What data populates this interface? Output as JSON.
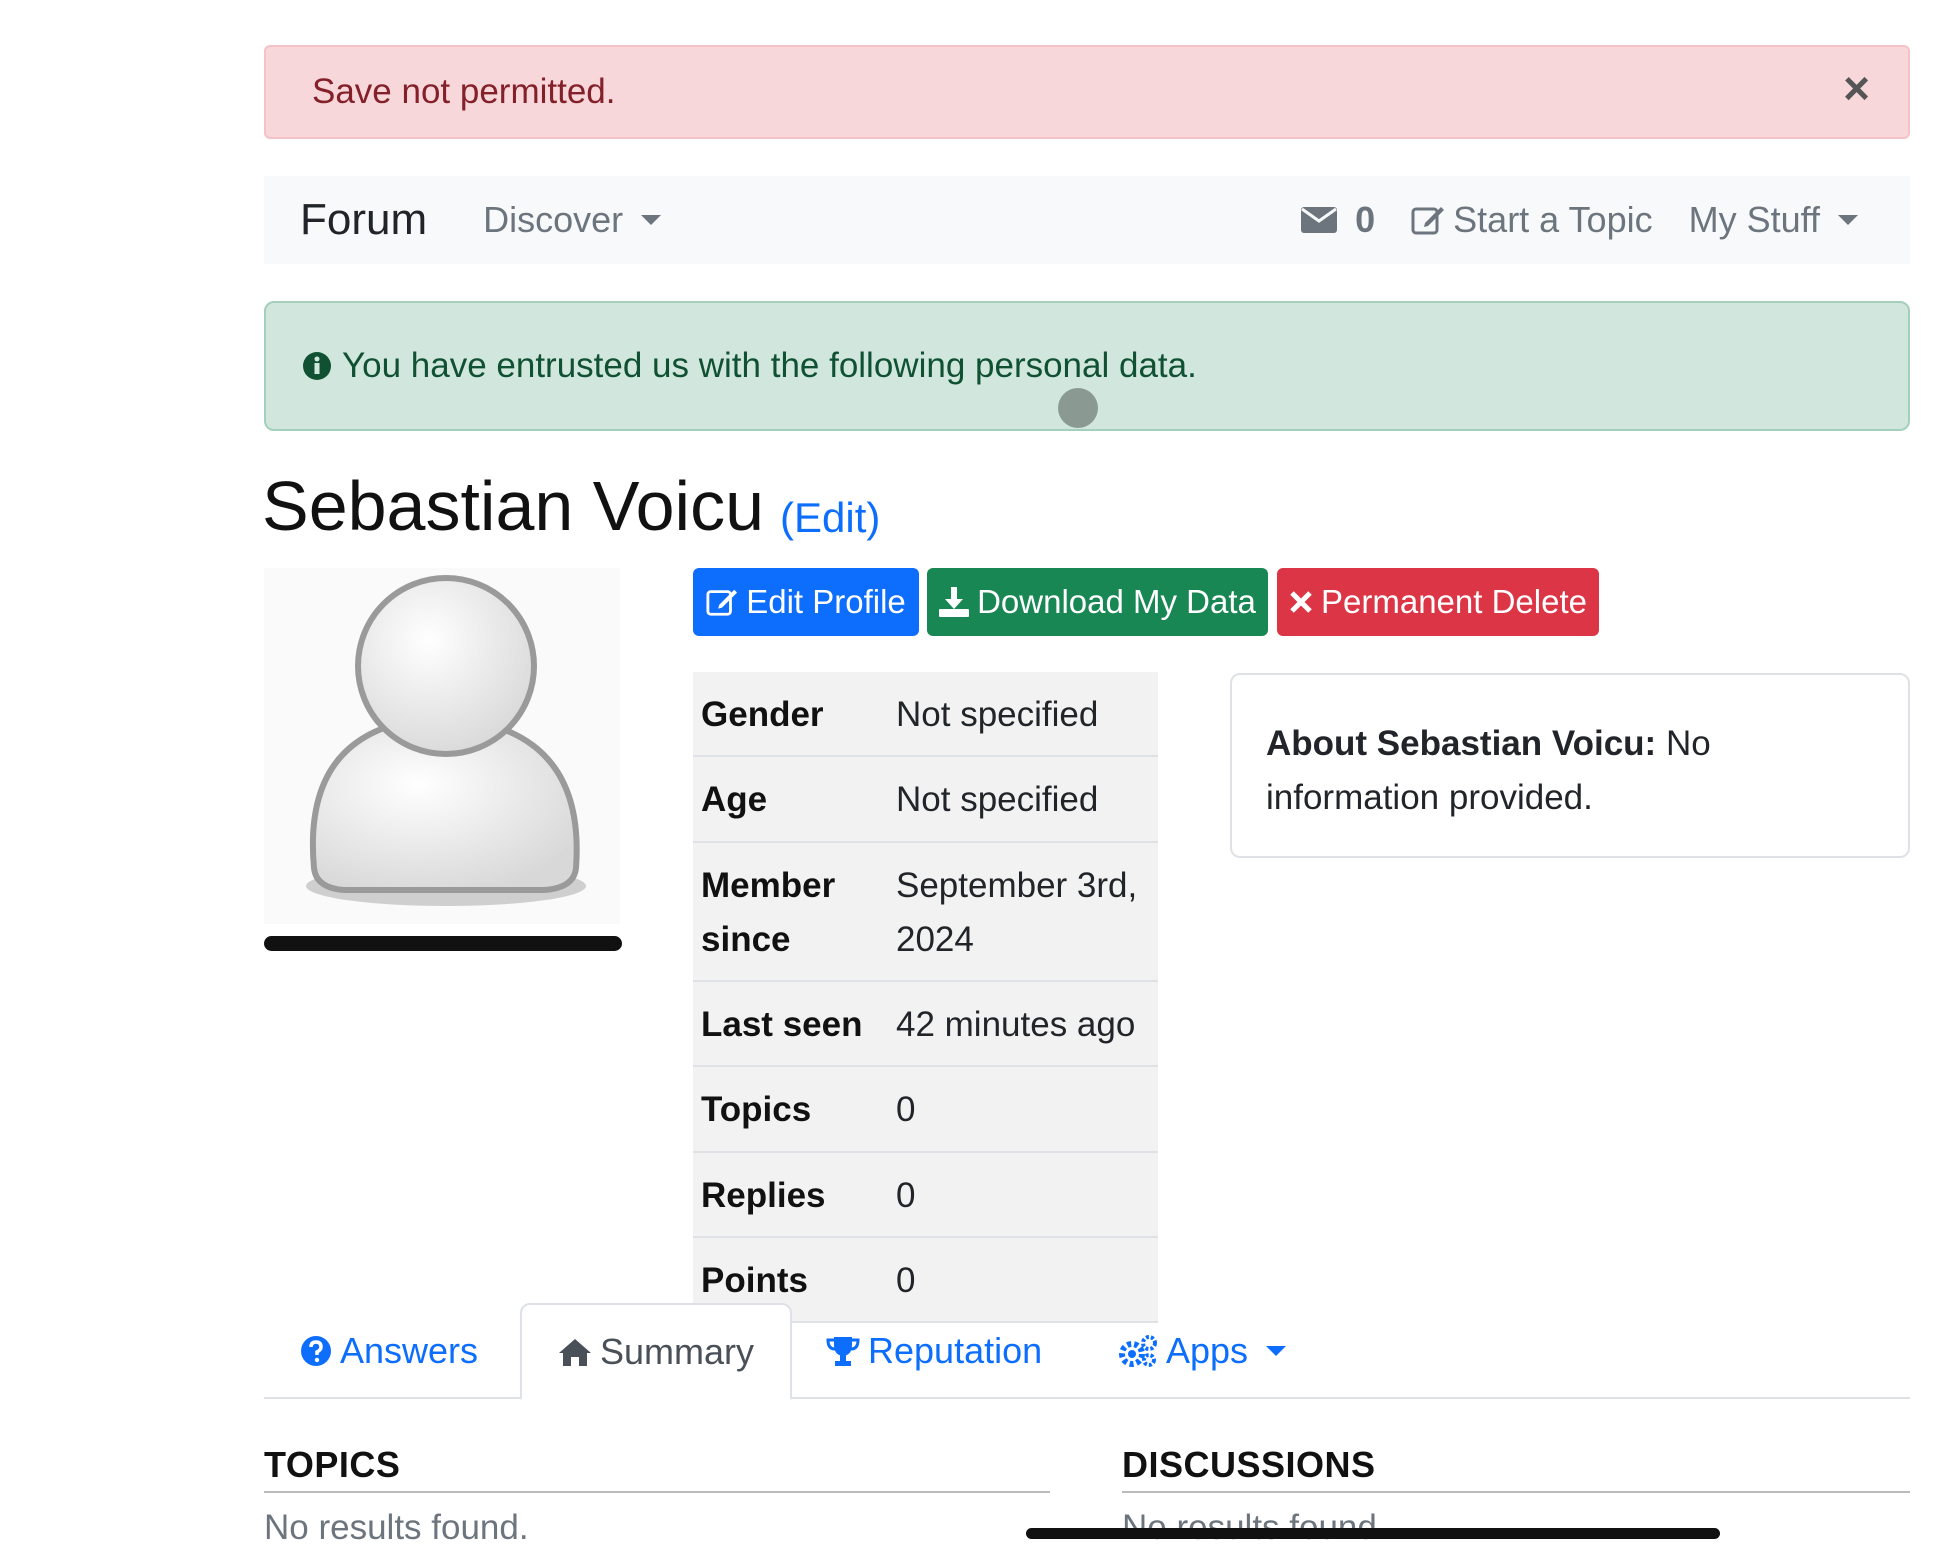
{
  "alert_error": {
    "message": "Save not permitted.",
    "close": "×"
  },
  "navbar": {
    "brand": "Forum",
    "discover": "Discover",
    "messages_count": "0",
    "start_topic": "Start a Topic",
    "my_stuff": "My Stuff"
  },
  "alert_info": {
    "message": "You have entrusted us with the following personal data."
  },
  "profile": {
    "name": "Sebastian Voicu",
    "edit_link": "(Edit)",
    "buttons": {
      "edit_profile": "Edit Profile",
      "download_data": "Download My Data",
      "permanent_delete": "Permanent Delete"
    },
    "fields": [
      {
        "label": "Gender",
        "value": "Not specified"
      },
      {
        "label": "Age",
        "value": "Not specified"
      },
      {
        "label": "Member since",
        "value": "September 3rd, 2024"
      },
      {
        "label": "Last seen",
        "value": "42 minutes ago"
      },
      {
        "label": "Topics",
        "value": "0"
      },
      {
        "label": "Replies",
        "value": "0"
      },
      {
        "label": "Points",
        "value": "0"
      }
    ],
    "about_label": "About Sebastian Voicu:",
    "about_text": " No information provided."
  },
  "tabs": [
    {
      "label": "Answers",
      "icon": "question-circle-icon"
    },
    {
      "label": "Summary",
      "icon": "home-icon",
      "active": true
    },
    {
      "label": "Reputation",
      "icon": "trophy-icon"
    },
    {
      "label": "Apps",
      "icon": "gears-icon"
    }
  ],
  "sections": {
    "topics_title": "TOPICS",
    "topics_empty": "No results found.",
    "discussions_title": "DISCUSSIONS",
    "discussions_empty": "No results found."
  },
  "colors": {
    "primary": "#0d6efd",
    "success": "#198754",
    "danger": "#dc3545",
    "alert_danger_bg": "#f8d7da",
    "alert_success_bg": "#d1e7dd"
  }
}
